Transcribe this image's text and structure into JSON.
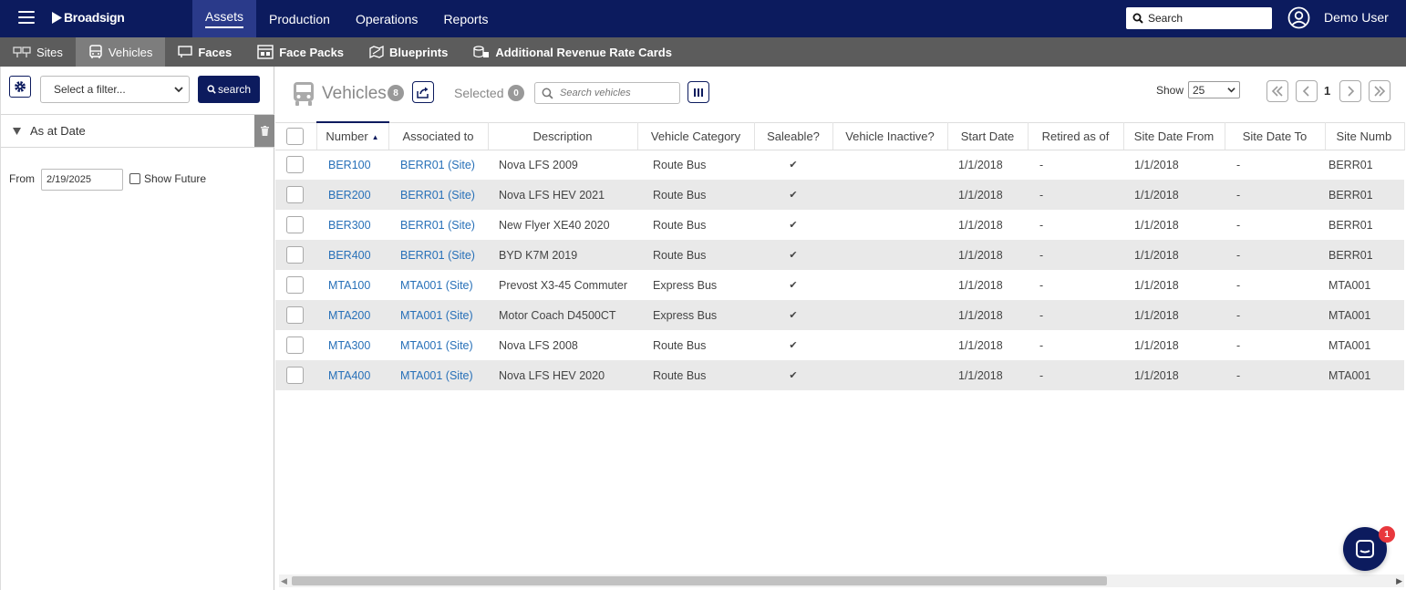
{
  "app": {
    "brand": "Broadsign"
  },
  "topnav": {
    "items": [
      {
        "label": "Assets",
        "active": true
      },
      {
        "label": "Production"
      },
      {
        "label": "Operations"
      },
      {
        "label": "Reports"
      }
    ],
    "search_placeholder": "Search",
    "user_name": "Demo User"
  },
  "subnav": {
    "items": [
      {
        "label": "Sites",
        "icon": "sites-icon"
      },
      {
        "label": "Vehicles",
        "icon": "bus-icon",
        "active": true
      },
      {
        "label": "Faces",
        "icon": "face-icon"
      },
      {
        "label": "Face Packs",
        "icon": "face-pack-icon"
      },
      {
        "label": "Blueprints",
        "icon": "blueprint-icon"
      },
      {
        "label": "Additional Revenue Rate Cards",
        "icon": "rate-card-icon"
      }
    ]
  },
  "filters": {
    "select_placeholder": "Select a filter...",
    "search_label": "search",
    "as_at_label": "As at Date",
    "from_label": "From",
    "from_value": "2/19/2025",
    "show_future_label": "Show Future",
    "show_future_checked": false
  },
  "list": {
    "title": "Vehicles",
    "count": "8",
    "selected_label": "Selected",
    "selected_count": "0",
    "search_placeholder": "Search vehicles",
    "show_label": "Show",
    "page_size": "25",
    "current_page": "1"
  },
  "table": {
    "columns": [
      "Number",
      "Associated to",
      "Description",
      "Vehicle Category",
      "Saleable?",
      "Vehicle Inactive?",
      "Start Date",
      "Retired as of",
      "Site Date From",
      "Site Date To",
      "Site Numb"
    ],
    "rows": [
      [
        "BER100",
        "BERR01 (Site)",
        "Nova LFS 2009",
        "Route Bus",
        "✔",
        "",
        "1/1/2018",
        "-",
        "1/1/2018",
        "-",
        "BERR01"
      ],
      [
        "BER200",
        "BERR01 (Site)",
        "Nova LFS HEV 2021",
        "Route Bus",
        "✔",
        "",
        "1/1/2018",
        "-",
        "1/1/2018",
        "-",
        "BERR01"
      ],
      [
        "BER300",
        "BERR01 (Site)",
        "New Flyer XE40 2020",
        "Route Bus",
        "✔",
        "",
        "1/1/2018",
        "-",
        "1/1/2018",
        "-",
        "BERR01"
      ],
      [
        "BER400",
        "BERR01 (Site)",
        "BYD K7M 2019",
        "Route Bus",
        "✔",
        "",
        "1/1/2018",
        "-",
        "1/1/2018",
        "-",
        "BERR01"
      ],
      [
        "MTA100",
        "MTA001 (Site)",
        "Prevost X3-45 Commuter",
        "Express Bus",
        "✔",
        "",
        "1/1/2018",
        "-",
        "1/1/2018",
        "-",
        "MTA001"
      ],
      [
        "MTA200",
        "MTA001 (Site)",
        "Motor Coach D4500CT",
        "Express Bus",
        "✔",
        "",
        "1/1/2018",
        "-",
        "1/1/2018",
        "-",
        "MTA001"
      ],
      [
        "MTA300",
        "MTA001 (Site)",
        "Nova LFS 2008",
        "Route Bus",
        "✔",
        "",
        "1/1/2018",
        "-",
        "1/1/2018",
        "-",
        "MTA001"
      ],
      [
        "MTA400",
        "MTA001 (Site)",
        "Nova LFS HEV 2020",
        "Route Bus",
        "✔",
        "",
        "1/1/2018",
        "-",
        "1/1/2018",
        "-",
        "MTA001"
      ]
    ]
  },
  "chat": {
    "badge": "1"
  },
  "colors": {
    "primary": "#0c1b5e",
    "subnav": "#5c5c5c",
    "link": "#2770b8",
    "alt_row": "#e9e9e9",
    "badge_red": "#e8383d"
  }
}
